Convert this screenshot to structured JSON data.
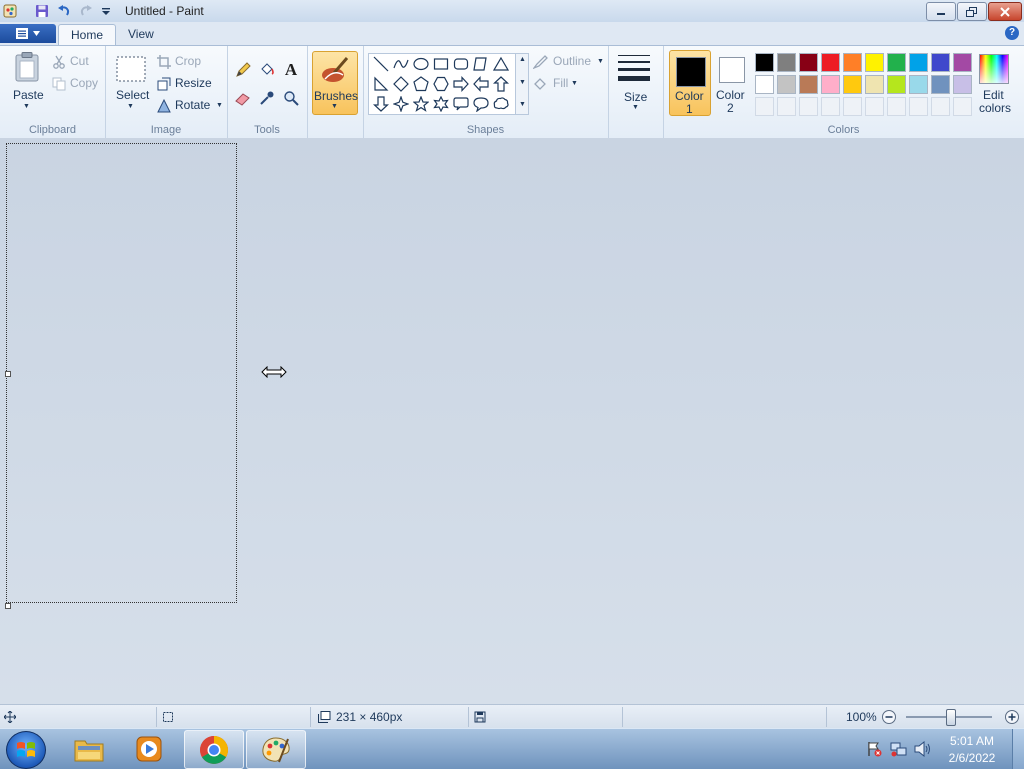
{
  "window": {
    "title": "Untitled - Paint"
  },
  "tabs": {
    "home": "Home",
    "view": "View"
  },
  "clipboard": {
    "paste": "Paste",
    "cut": "Cut",
    "copy": "Copy",
    "group": "Clipboard"
  },
  "image": {
    "select": "Select",
    "crop": "Crop",
    "resize": "Resize",
    "rotate": "Rotate",
    "group": "Image"
  },
  "tools": {
    "group": "Tools",
    "text_glyph": "A"
  },
  "brushes": {
    "label": "Brushes"
  },
  "shapes": {
    "outline": "Outline",
    "fill": "Fill",
    "group": "Shapes"
  },
  "size": {
    "label": "Size"
  },
  "colors": {
    "color1_line1": "Color",
    "color1_line2": "1",
    "color2_line1": "Color",
    "color2_line2": "2",
    "edit_line1": "Edit",
    "edit_line2": "colors",
    "group": "Colors",
    "color1_value": "#000000",
    "color2_value": "#ffffff",
    "palette_row1": [
      "#000000",
      "#7f7f7f",
      "#880015",
      "#ed1c24",
      "#ff7f27",
      "#fff200",
      "#22b14c",
      "#00a2e8",
      "#3f48cc",
      "#a349a4"
    ],
    "palette_row2": [
      "#ffffff",
      "#c3c3c3",
      "#b97a57",
      "#ffaec9",
      "#ffc90e",
      "#efe4b0",
      "#b5e61d",
      "#99d9ea",
      "#7092be",
      "#c8bfe7"
    ]
  },
  "status": {
    "dimensions": "231 × 460px",
    "zoom": "100%"
  },
  "taskbar": {
    "time": "5:01 AM",
    "date": "2/6/2022"
  }
}
